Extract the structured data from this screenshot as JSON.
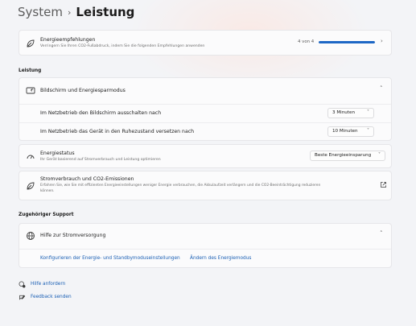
{
  "breadcrumb": {
    "parent": "System",
    "separator": "›",
    "current": "Leistung"
  },
  "recommendations": {
    "title": "Energieempfehlungen",
    "subtitle": "Verringern Sie Ihren CO2-Fußabdruck, indem Sie die folgenden Empfehlungen anwenden",
    "progress_text": "4 von 4",
    "progress_fraction": 1.0
  },
  "section_leistung": "Leistung",
  "display_group": {
    "title": "Bildschirm und Energiesparmodus",
    "rows": [
      {
        "label": "Im Netzbetrieb den Bildschirm ausschalten nach",
        "value": "3 Minuten"
      },
      {
        "label": "Im Netzbetrieb das Gerät in den Ruhezustand versetzen nach",
        "value": "10 Minuten"
      }
    ]
  },
  "energy_status": {
    "title": "Energiestatus",
    "subtitle": "Ihr Gerät basierend auf Stromverbrauch und Leistung optimieren",
    "value": "Beste Energieeinsparung"
  },
  "co2": {
    "title": "Stromverbrauch und CO2-Emissionen",
    "subtitle_line1": "Erfahren Sie, wie Sie mit effizienten Energieeinstellungen weniger Energie verbrauchen, die Akkulaufzeit verlängern und die CO2-Beeinträchtigung reduzieren",
    "subtitle_line2": "können."
  },
  "section_support": "Zugehöriger Support",
  "support": {
    "title": "Hilfe zur Stromversorgung",
    "links": [
      "Konfigurieren der Energie- und Standbymoduseinstellungen",
      "Ändern des Energiemodus"
    ]
  },
  "footer": {
    "help": "Hilfe anfordern",
    "feedback": "Feedback senden"
  },
  "colors": {
    "accent": "#1d67c5",
    "link": "#1a5fb4"
  }
}
